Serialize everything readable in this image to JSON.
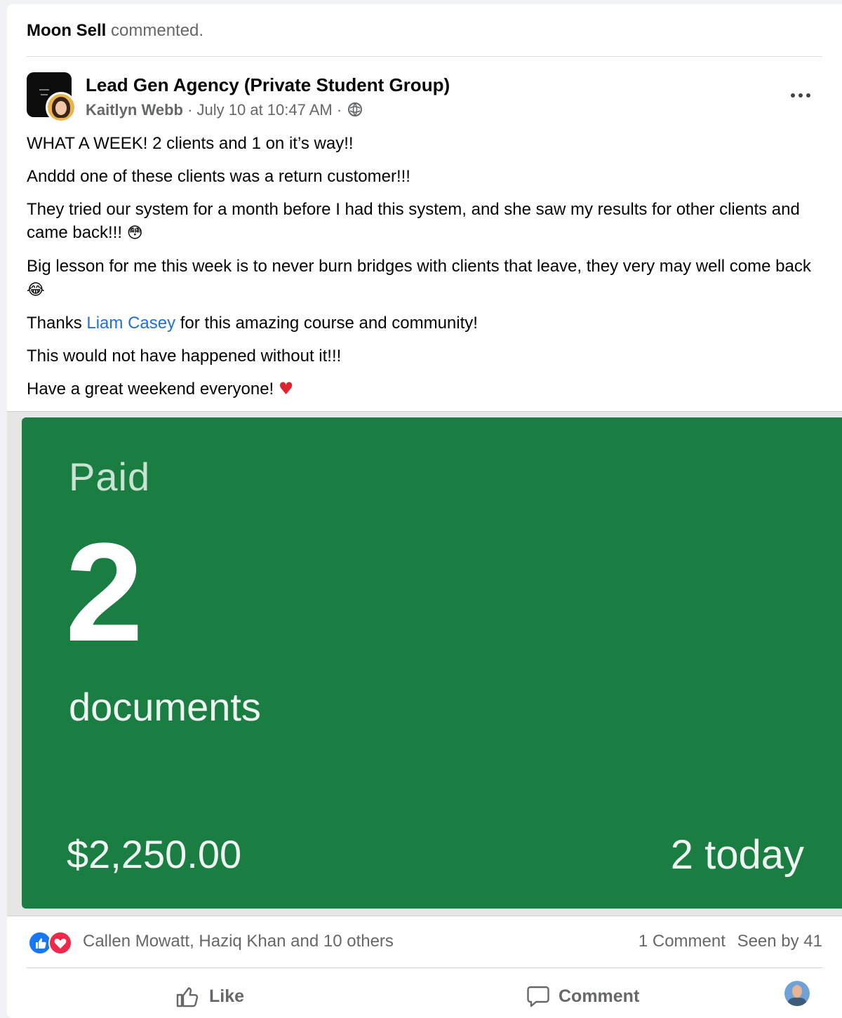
{
  "activity": {
    "actor": "Moon Sell",
    "action": "commented."
  },
  "post": {
    "group_name": "Lead Gen Agency (Private Student Group)",
    "author": "Kaitlyn Webb",
    "timestamp": "July 10 at 10:47 AM",
    "separator": "·",
    "audience_icon": "globe-icon",
    "more_icon": "more-options-icon",
    "lines": {
      "l1": "WHAT A WEEK! 2 clients and 1 on it’s way!!",
      "l2": "Anddd one of these clients was a return customer!!!",
      "l3": "They tried our system for a month before I had this system, and she saw my results for other clients and came back!!!",
      "l3_emoji": "😳",
      "l4": "Big lesson for me this week is to never burn bridges with clients that leave, they very may well come back",
      "l4_emoji": "😂",
      "l5_pre": "Thanks ",
      "l5_mention": "Liam Casey",
      "l5_post": " for this amazing course and community!",
      "l6": "This would not have happened without it!!!",
      "l7": "Have a great weekend everyone!",
      "l7_emoji": "♥"
    }
  },
  "image": {
    "title": "Paid",
    "count": "2",
    "unit": "documents",
    "amount": "$2,250.00",
    "today": "2 today",
    "background_color": "#1a7e43"
  },
  "reactions": {
    "icons": [
      "like-reaction-icon",
      "love-reaction-icon"
    ],
    "names": "Callen Mowatt, Haziq Khan and 10 others",
    "comments": "1 Comment",
    "seen": "Seen by 41"
  },
  "actions": {
    "like_label": "Like",
    "comment_label": "Comment"
  },
  "colors": {
    "link": "#216fdb",
    "muted_text": "#65676b",
    "like_blue": "#1877f2",
    "love_red": "#f02849"
  }
}
